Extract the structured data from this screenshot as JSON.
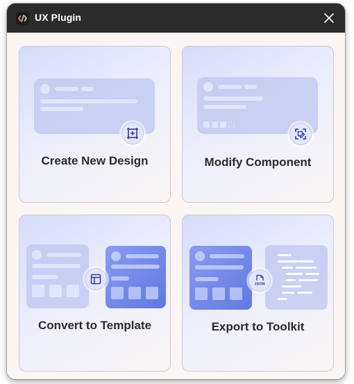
{
  "window": {
    "title": "UX Plugin",
    "close_icon": "close-icon",
    "app_icon": "code-icon"
  },
  "cards": [
    {
      "label": "Create New Design",
      "icon": "add-frame-icon"
    },
    {
      "label": "Modify Component",
      "icon": "edit-frame-icon"
    },
    {
      "label": "Convert to Template",
      "icon": "layout-template-icon"
    },
    {
      "label": "Export to Toolkit",
      "icon": "json-file-icon",
      "icon_text": "JSON"
    }
  ],
  "colors": {
    "titlebar": "#2b2b2b",
    "accent": "#2e3b8f",
    "panel_dark": "#5f78e3"
  }
}
